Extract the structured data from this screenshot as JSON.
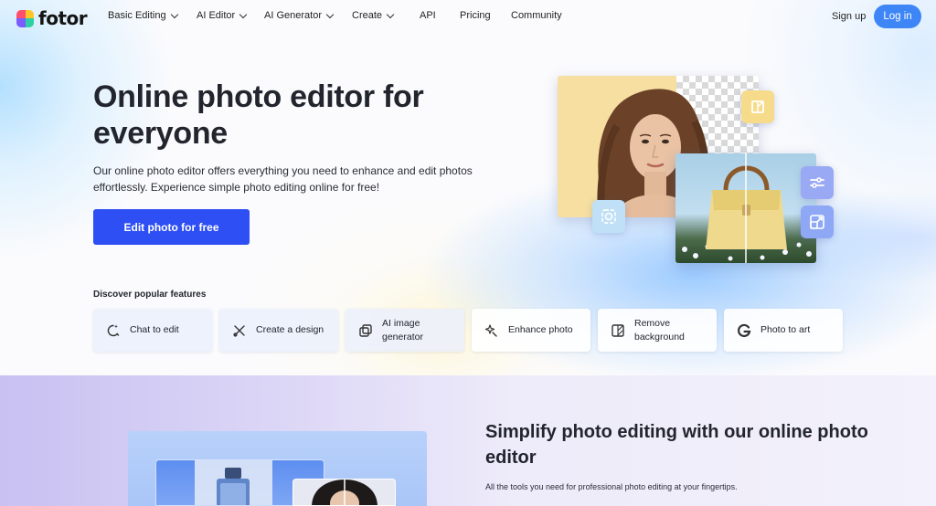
{
  "brand": {
    "name": "fotor"
  },
  "nav": {
    "items": [
      {
        "label": "Basic Editing",
        "has_dropdown": true
      },
      {
        "label": "AI Editor",
        "has_dropdown": true
      },
      {
        "label": "AI Generator",
        "has_dropdown": true
      },
      {
        "label": "Create",
        "has_dropdown": true
      },
      {
        "label": "API",
        "has_dropdown": false
      },
      {
        "label": "Pricing",
        "has_dropdown": false
      },
      {
        "label": "Community",
        "has_dropdown": false
      }
    ],
    "sign_up": "Sign up",
    "log_in": "Log in"
  },
  "hero": {
    "title": "Online photo editor for everyone",
    "description": "Our online photo editor offers everything you need to enhance and edit photos effortlessly. Experience simple photo editing online for free!",
    "cta": "Edit photo for free",
    "discover_label": "Discover popular features",
    "features": [
      {
        "label": "Chat to edit",
        "icon": "chat-edit-icon"
      },
      {
        "label": "Create a design",
        "icon": "design-tools-icon"
      },
      {
        "label": "AI image generator",
        "icon": "ai-image-icon"
      },
      {
        "label": "Enhance photo",
        "icon": "sparkle-enhance-icon"
      },
      {
        "label": "Remove background",
        "icon": "remove-bg-icon"
      },
      {
        "label": "Photo to art",
        "icon": "photo-art-icon"
      }
    ]
  },
  "section2": {
    "title": "Simplify photo editing with our online photo editor",
    "subtitle": "All the tools you need for professional photo editing at your fingertips."
  },
  "colors": {
    "accent": "#2e4ff3",
    "login": "#3e86f6",
    "float_buttons": [
      "#f6dc8a",
      "#bfe0f7",
      "#9aa9f3",
      "#8fa8f6"
    ]
  }
}
